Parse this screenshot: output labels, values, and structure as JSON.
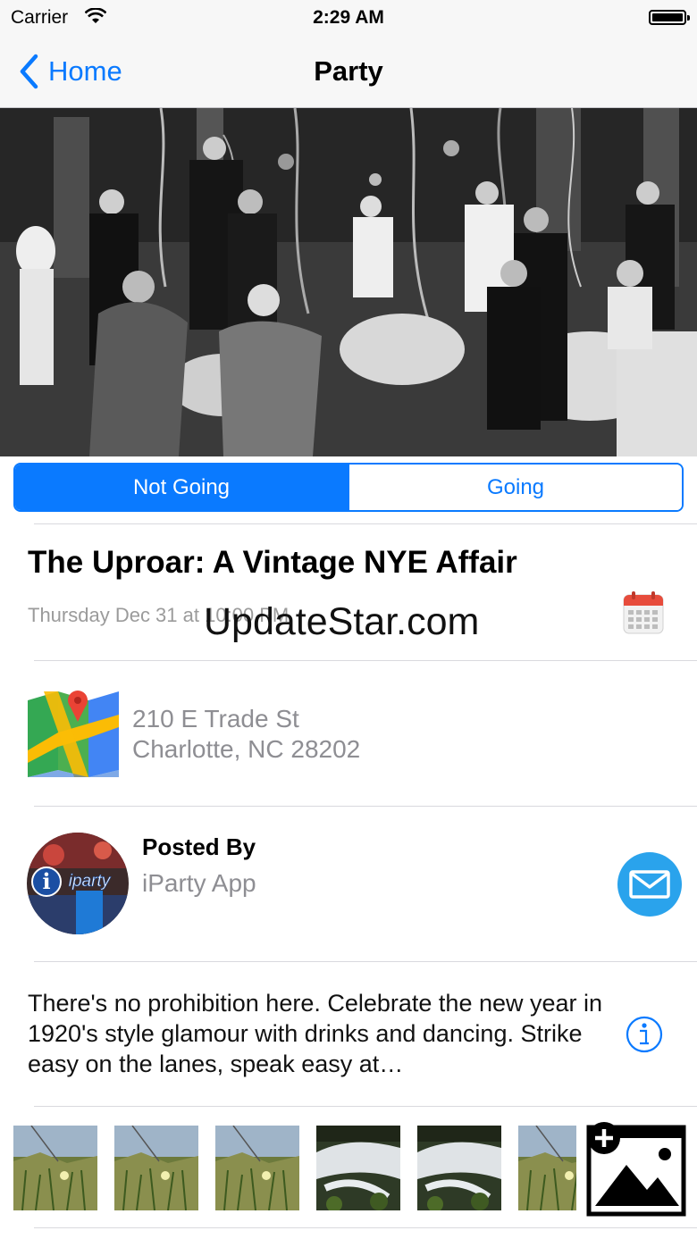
{
  "status_bar": {
    "carrier": "Carrier",
    "time": "2:29 AM"
  },
  "nav": {
    "back_label": "Home",
    "title": "Party"
  },
  "segment": {
    "options": [
      "Not Going",
      "Going"
    ],
    "selected": "Not Going"
  },
  "event": {
    "title": "The Uproar: A Vintage NYE Affair",
    "datetime": "Thursday Dec 31 at 10:00 PM"
  },
  "watermark": "UpdateStar.com",
  "location": {
    "line1": "210 E Trade St",
    "line2": "Charlotte, NC 28202"
  },
  "poster": {
    "label": "Posted By",
    "name": "iParty App",
    "avatar_text": "iparty"
  },
  "description": "There's no prohibition here. Celebrate the new year in 1920's style glamour with drinks and dancing. Strike easy on the lanes, speak easy at…",
  "photos": [
    "meadow",
    "meadow",
    "meadow",
    "waterfall",
    "waterfall",
    "meadow"
  ],
  "colors": {
    "accent": "#0a7aff",
    "mail": "#2aa3ec",
    "calendar_red": "#e74c3c"
  },
  "icons": {
    "back": "chevron-left-icon",
    "calendar": "calendar-icon",
    "map": "map-icon",
    "mail": "mail-icon",
    "info": "info-icon",
    "add_photo": "add-photo-icon"
  }
}
